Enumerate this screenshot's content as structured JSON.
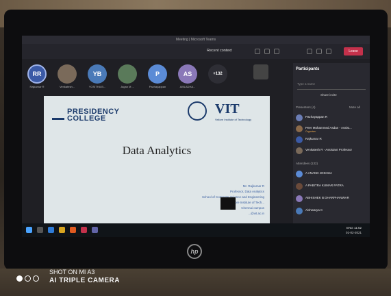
{
  "teams": {
    "window_title": "Meeting | Microsoft Teams",
    "toolbar": {
      "recent_context": "Recent context",
      "leave_label": "Leave"
    },
    "participants": [
      {
        "initials": "RR",
        "name": "Rajkumar R",
        "color": "#3b5aa6"
      },
      {
        "initials": "",
        "name": "Venkatesh...",
        "color": "#7a6a5a"
      },
      {
        "initials": "YB",
        "name": "YOSITHA B...",
        "color": "#4a7ab8"
      },
      {
        "initials": "",
        "name": "Jagan M ...",
        "color": "#5a7a5a"
      },
      {
        "initials": "P",
        "name": "Pazhayappan",
        "color": "#5b8bd6"
      },
      {
        "initials": "AS",
        "name": "AMLADHA...",
        "color": "#8a78b8"
      },
      {
        "initials": "+132",
        "name": "",
        "color": "#2e2e35"
      }
    ],
    "slide": {
      "college_line1": "PRESIDENCY",
      "college_line2": "COLLEGE",
      "vit": "VIT",
      "vit_sub": "Vellore Institute of Technology",
      "title": "Data Analytics",
      "credits": [
        "Mr. Rajkumar R",
        "Professor, Data Analytics",
        "School of Computer Science and Engineering",
        "Vellore Institute of Tech...",
        "Chennai campus",
        "...@vit.ac.in"
      ]
    },
    "self_label": "Rajkumar R",
    "panel": {
      "title": "Participants",
      "search_placeholder": "Type a name",
      "share_invite": "Share invite",
      "presenters_label": "Presenters (4)",
      "mute_all": "Mute all",
      "presenters": [
        {
          "name": "Pazhayappan R",
          "sub": ""
        },
        {
          "name": "Peer Mohammed Asdan - Assist...",
          "sub": "Organiser"
        },
        {
          "name": "Rajkumar R",
          "sub": ""
        },
        {
          "name": "Venkatesh R - Assistant Professor",
          "sub": ""
        }
      ],
      "attendees_label": "Attendees (132)",
      "attendees": [
        {
          "name": "A ANAND JOSHUA"
        },
        {
          "name": "A PABITRA KUMAR PATRA"
        },
        {
          "name": "ABHISHEK B DHARPHANWAR"
        },
        {
          "name": "Aishwarya C"
        }
      ]
    },
    "clock": {
      "time": "11:52",
      "date": "01-02-2021",
      "lang": "ENG"
    }
  },
  "brand": {
    "laptop_logo": "hp"
  },
  "watermark": {
    "line1": "SHOT ON MI A3",
    "line2": "AI TRIPLE CAMERA"
  }
}
